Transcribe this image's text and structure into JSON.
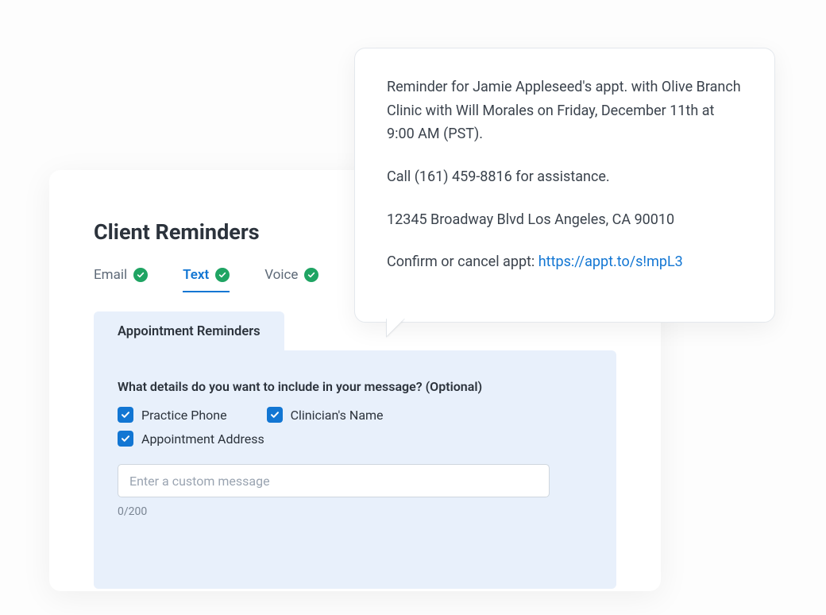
{
  "header": {
    "title": "Client Reminders"
  },
  "tabs": {
    "email": "Email",
    "text": "Text",
    "voice": "Voice"
  },
  "panel": {
    "tab_label": "Appointment Reminders",
    "question": "What details do you want to include in your message? (Optional)",
    "options": {
      "practice_phone": "Practice Phone",
      "clinicians_name": "Clinician's Name",
      "appointment_address": "Appointment Address"
    },
    "custom_message_placeholder": "Enter a custom message",
    "counter": "0/200"
  },
  "preview": {
    "line1": "Reminder for Jamie Appleseed's appt. with Olive Branch Clinic with Will Morales on Friday, December 11th at 9:00 AM (PST).",
    "line2": "Call (161) 459-8816 for assistance.",
    "line3": "12345 Broadway Blvd Los Angeles, CA 90010",
    "line4_prefix": "Confirm or cancel appt: ",
    "line4_link": "https://appt.to/s!mpL3"
  }
}
